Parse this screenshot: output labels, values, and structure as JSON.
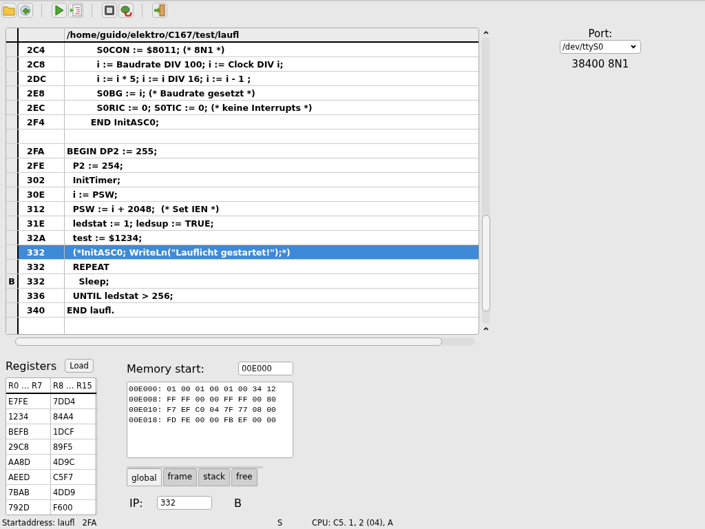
{
  "source": {
    "path": "/home/guido/elektro/C167/test/laufl",
    "rows": [
      {
        "marker": "",
        "address": "2C4",
        "code": "          S0CON := $8011; (* 8N1 *)",
        "selected": false
      },
      {
        "marker": "",
        "address": "2C8",
        "code": "          i := Baudrate DIV 100; i := Clock DIV i;",
        "selected": false
      },
      {
        "marker": "",
        "address": "2DC",
        "code": "          i := i * 5; i := i DIV 16; i := i - 1 ;",
        "selected": false
      },
      {
        "marker": "",
        "address": "2E8",
        "code": "          S0BG := i; (* Baudrate gesetzt *)",
        "selected": false
      },
      {
        "marker": "",
        "address": "2EC",
        "code": "          S0RIC := 0; S0TIC := 0; (* keine Interrupts *)",
        "selected": false
      },
      {
        "marker": "",
        "address": "2F4",
        "code": "        END InitASC0;",
        "selected": false
      },
      {
        "marker": "",
        "address": "",
        "code": "",
        "selected": false
      },
      {
        "marker": "",
        "address": "2FA",
        "code": "BEGIN DP2 := 255;",
        "selected": false
      },
      {
        "marker": "",
        "address": "2FE",
        "code": "  P2 := 254;",
        "selected": false
      },
      {
        "marker": "",
        "address": "302",
        "code": "  InitTimer;",
        "selected": false
      },
      {
        "marker": "",
        "address": "30E",
        "code": "  i := PSW;",
        "selected": false
      },
      {
        "marker": "",
        "address": "312",
        "code": "  PSW := i + 2048;  (* Set IEN *)",
        "selected": false
      },
      {
        "marker": "",
        "address": "31E",
        "code": "  ledstat := 1; ledsup := TRUE;",
        "selected": false
      },
      {
        "marker": "",
        "address": "32A",
        "code": "  test := $1234;",
        "selected": false
      },
      {
        "marker": "",
        "address": "332",
        "code": "  (*InitASC0; WriteLn(\"Lauflicht gestartet!\");*)",
        "selected": true
      },
      {
        "marker": "",
        "address": "332",
        "code": "  REPEAT",
        "selected": false
      },
      {
        "marker": "B",
        "address": "332",
        "code": "    Sleep;",
        "selected": false
      },
      {
        "marker": "",
        "address": "336",
        "code": "  UNTIL ledstat > 256;",
        "selected": false
      },
      {
        "marker": "",
        "address": "340",
        "code": "END laufl.",
        "selected": false
      }
    ]
  },
  "port": {
    "label": "Port:",
    "value": "/dev/ttyS0",
    "settings": "38400 8N1"
  },
  "registers": {
    "title": "Registers",
    "load_button": "Load",
    "columns": [
      "R0 … R7",
      "R8 … R15"
    ],
    "rows": [
      [
        "E7FE",
        "7DD4"
      ],
      [
        "1234",
        "84A4"
      ],
      [
        "BEFB",
        "1DCF"
      ],
      [
        "29C8",
        "89F5"
      ],
      [
        "AA8D",
        "4D9C"
      ],
      [
        "AEED",
        "C5F7"
      ],
      [
        "7BAB",
        "4DD9"
      ],
      [
        "792D",
        "F600"
      ]
    ]
  },
  "memory": {
    "label": "Memory start:",
    "start": "00E000",
    "lines": [
      "00E000: 01 00 01 00 01 00 34 12",
      "00E008: FF FF 00 00 FF FF 00 80",
      "00E010: F7 EF C0 04 7F 77 08 00",
      "00E018: FD FE 00 00 FB EF 00 00"
    ],
    "tabs": [
      {
        "label": "global",
        "selected": true
      },
      {
        "label": "frame",
        "selected": false
      },
      {
        "label": "stack",
        "selected": false
      },
      {
        "label": "free",
        "selected": false
      }
    ]
  },
  "ip": {
    "label": "IP:",
    "value": "332",
    "flag": "B"
  },
  "status_bar": {
    "start": "Startaddress: laufl   2FA",
    "mode": "S",
    "cpu": "CPU: C5. 1, 2 (04), A"
  }
}
